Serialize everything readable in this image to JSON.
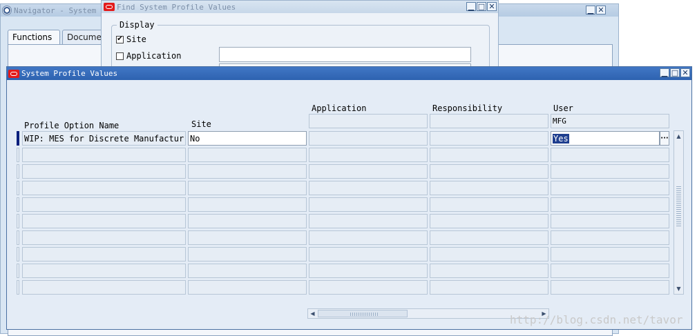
{
  "navigator": {
    "title": "Navigator - System Adm",
    "tabs": [
      {
        "label": "Functions"
      },
      {
        "label": "Documen"
      }
    ],
    "controls": {
      "minimize": "▁",
      "close": "✕"
    }
  },
  "find_window": {
    "title": "Find System Profile Values",
    "display_legend": "Display",
    "site_label": "Site",
    "site_checked": true,
    "application_label": "Application",
    "application_checked": false,
    "application_value": "",
    "controls": {
      "minimize": "▁",
      "maximize": "□",
      "close": "✕"
    }
  },
  "profile_window": {
    "title": "System Profile Values",
    "controls": {
      "minimize": "▁",
      "maximize": "□",
      "close": "✕"
    },
    "headers": {
      "profile_option_name": "Profile Option Name",
      "site": "Site",
      "application": "Application",
      "responsibility": "Responsibility",
      "user": "User"
    },
    "context": {
      "application": "",
      "responsibility": "",
      "user": "MFG"
    },
    "rows": [
      {
        "name": "WIP: MES for Discrete Manufacturing",
        "site": "No",
        "application": "",
        "responsibility": "",
        "user": "Yes"
      },
      {
        "name": "",
        "site": "",
        "application": "",
        "responsibility": "",
        "user": ""
      },
      {
        "name": "",
        "site": "",
        "application": "",
        "responsibility": "",
        "user": ""
      },
      {
        "name": "",
        "site": "",
        "application": "",
        "responsibility": "",
        "user": ""
      },
      {
        "name": "",
        "site": "",
        "application": "",
        "responsibility": "",
        "user": ""
      },
      {
        "name": "",
        "site": "",
        "application": "",
        "responsibility": "",
        "user": ""
      },
      {
        "name": "",
        "site": "",
        "application": "",
        "responsibility": "",
        "user": ""
      },
      {
        "name": "",
        "site": "",
        "application": "",
        "responsibility": "",
        "user": ""
      },
      {
        "name": "",
        "site": "",
        "application": "",
        "responsibility": "",
        "user": ""
      },
      {
        "name": "",
        "site": "",
        "application": "",
        "responsibility": "",
        "user": ""
      }
    ],
    "lov_button": "···",
    "scroll_up": "▲",
    "scroll_down": "▼",
    "scroll_left": "◀",
    "scroll_right": "▶"
  },
  "watermark": "http://blog.csdn.net/tavor",
  "colors": {
    "titlebar_active": "#2d62b0",
    "row_indicator": "#0a1f7d",
    "selection": "#1f3f8f"
  }
}
